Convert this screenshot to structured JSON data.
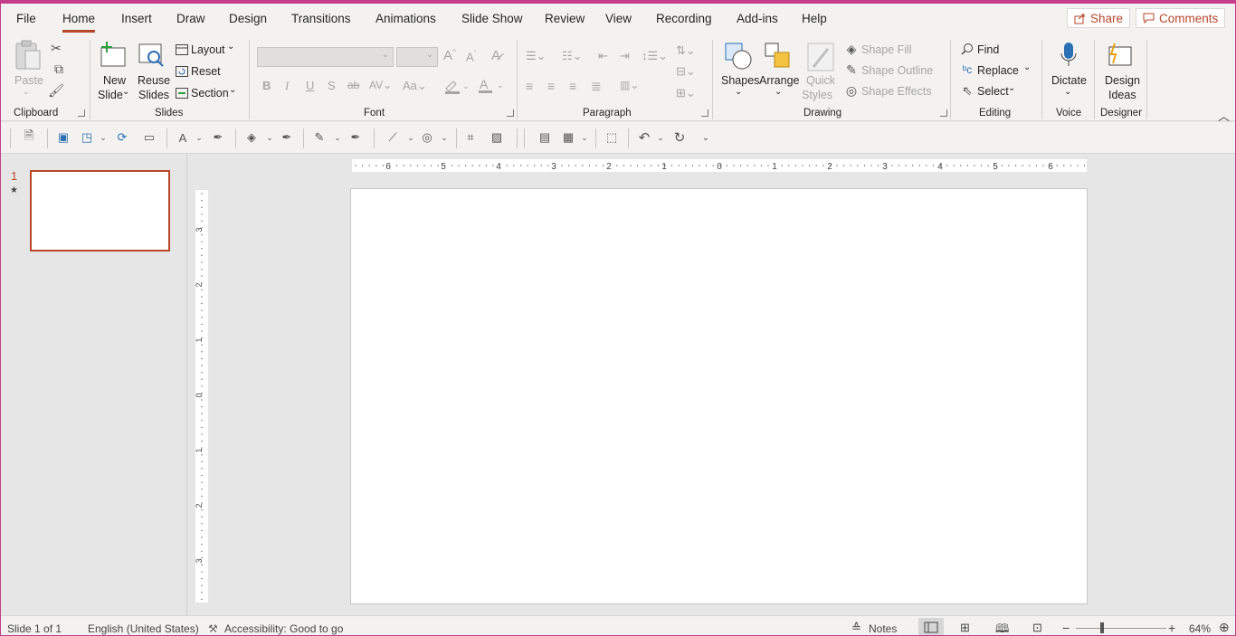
{
  "menu": {
    "tabs": [
      "File",
      "Home",
      "Insert",
      "Draw",
      "Design",
      "Transitions",
      "Animations",
      "Slide Show",
      "Review",
      "View",
      "Recording",
      "Add-ins",
      "Help"
    ],
    "active": "Home",
    "share": "Share",
    "comments": "Comments"
  },
  "ribbon": {
    "clipboard": {
      "paste": "Paste",
      "group": "Clipboard"
    },
    "slides": {
      "new_slide_1": "New",
      "new_slide_2": "Slide",
      "reuse_1": "Reuse",
      "reuse_2": "Slides",
      "layout": "Layout",
      "reset": "Reset",
      "section": "Section",
      "group": "Slides"
    },
    "font": {
      "group": "Font",
      "bold": "B",
      "italic": "I",
      "underline": "U",
      "shadow": "S",
      "strike": "ab"
    },
    "paragraph": {
      "group": "Paragraph"
    },
    "drawing": {
      "shapes": "Shapes",
      "arrange": "Arrange",
      "quick_1": "Quick",
      "quick_2": "Styles",
      "shape_fill": "Shape Fill",
      "shape_outline": "Shape Outline",
      "shape_effects": "Shape Effects",
      "group": "Drawing"
    },
    "editing": {
      "find": "Find",
      "replace": "Replace",
      "select": "Select",
      "group": "Editing"
    },
    "voice": {
      "dictate": "Dictate",
      "group": "Voice"
    },
    "designer": {
      "ideas_1": "Design",
      "ideas_2": "Ideas",
      "group": "Designer"
    }
  },
  "slides_pane": {
    "number": "1",
    "star": "★"
  },
  "rulers": {
    "h": [
      "6",
      "5",
      "4",
      "3",
      "2",
      "1",
      "0",
      "1",
      "2",
      "3",
      "4",
      "5",
      "6"
    ],
    "v": [
      "3",
      "2",
      "1",
      "0",
      "1",
      "2",
      "3"
    ]
  },
  "status": {
    "slide": "Slide 1 of 1",
    "language": "English (United States)",
    "accessibility": "Accessibility: Good to go",
    "notes": "Notes",
    "zoom": "64%"
  },
  "colors": {
    "accent": "#b7472a",
    "frame": "#c43d8a"
  }
}
